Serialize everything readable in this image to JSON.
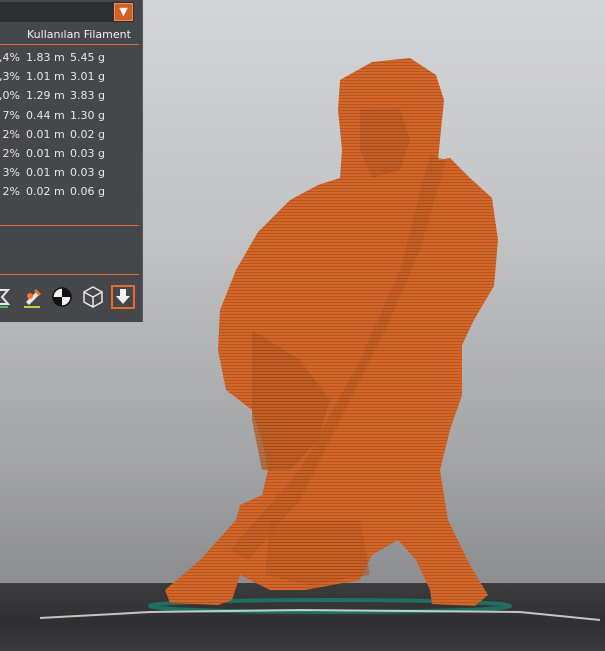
{
  "preset": {
    "dropdown_glyph": "▼"
  },
  "table": {
    "header": "Kullanılan Filament",
    "rows": [
      {
        "pct": ",4%",
        "length": "1.83 m",
        "weight": "5.45 g"
      },
      {
        "pct": ",3%",
        "length": "1.01 m",
        "weight": "3.01 g"
      },
      {
        "pct": ",0%",
        "length": "1.29 m",
        "weight": "3.83 g"
      },
      {
        "pct": "7%",
        "length": "0.44 m",
        "weight": "1.30 g"
      },
      {
        "pct": "2%",
        "length": "0.01 m",
        "weight": "0.02 g"
      },
      {
        "pct": "2%",
        "length": "0.01 m",
        "weight": "0.03 g"
      },
      {
        "pct": "3%",
        "length": "0.01 m",
        "weight": "0.03 g"
      },
      {
        "pct": "2%",
        "length": "0.02 m",
        "weight": "0.06 g"
      }
    ]
  },
  "toolbar": {
    "tools": [
      "layer-height-icon",
      "color-legend-icon",
      "shell-view-icon",
      "wireframe-cube-icon",
      "export-arrow-icon"
    ]
  },
  "colors": {
    "model": "#d3672a",
    "accent": "#e06e2f",
    "panel": "#45474a",
    "plate_outline": "#1f6f5e"
  }
}
